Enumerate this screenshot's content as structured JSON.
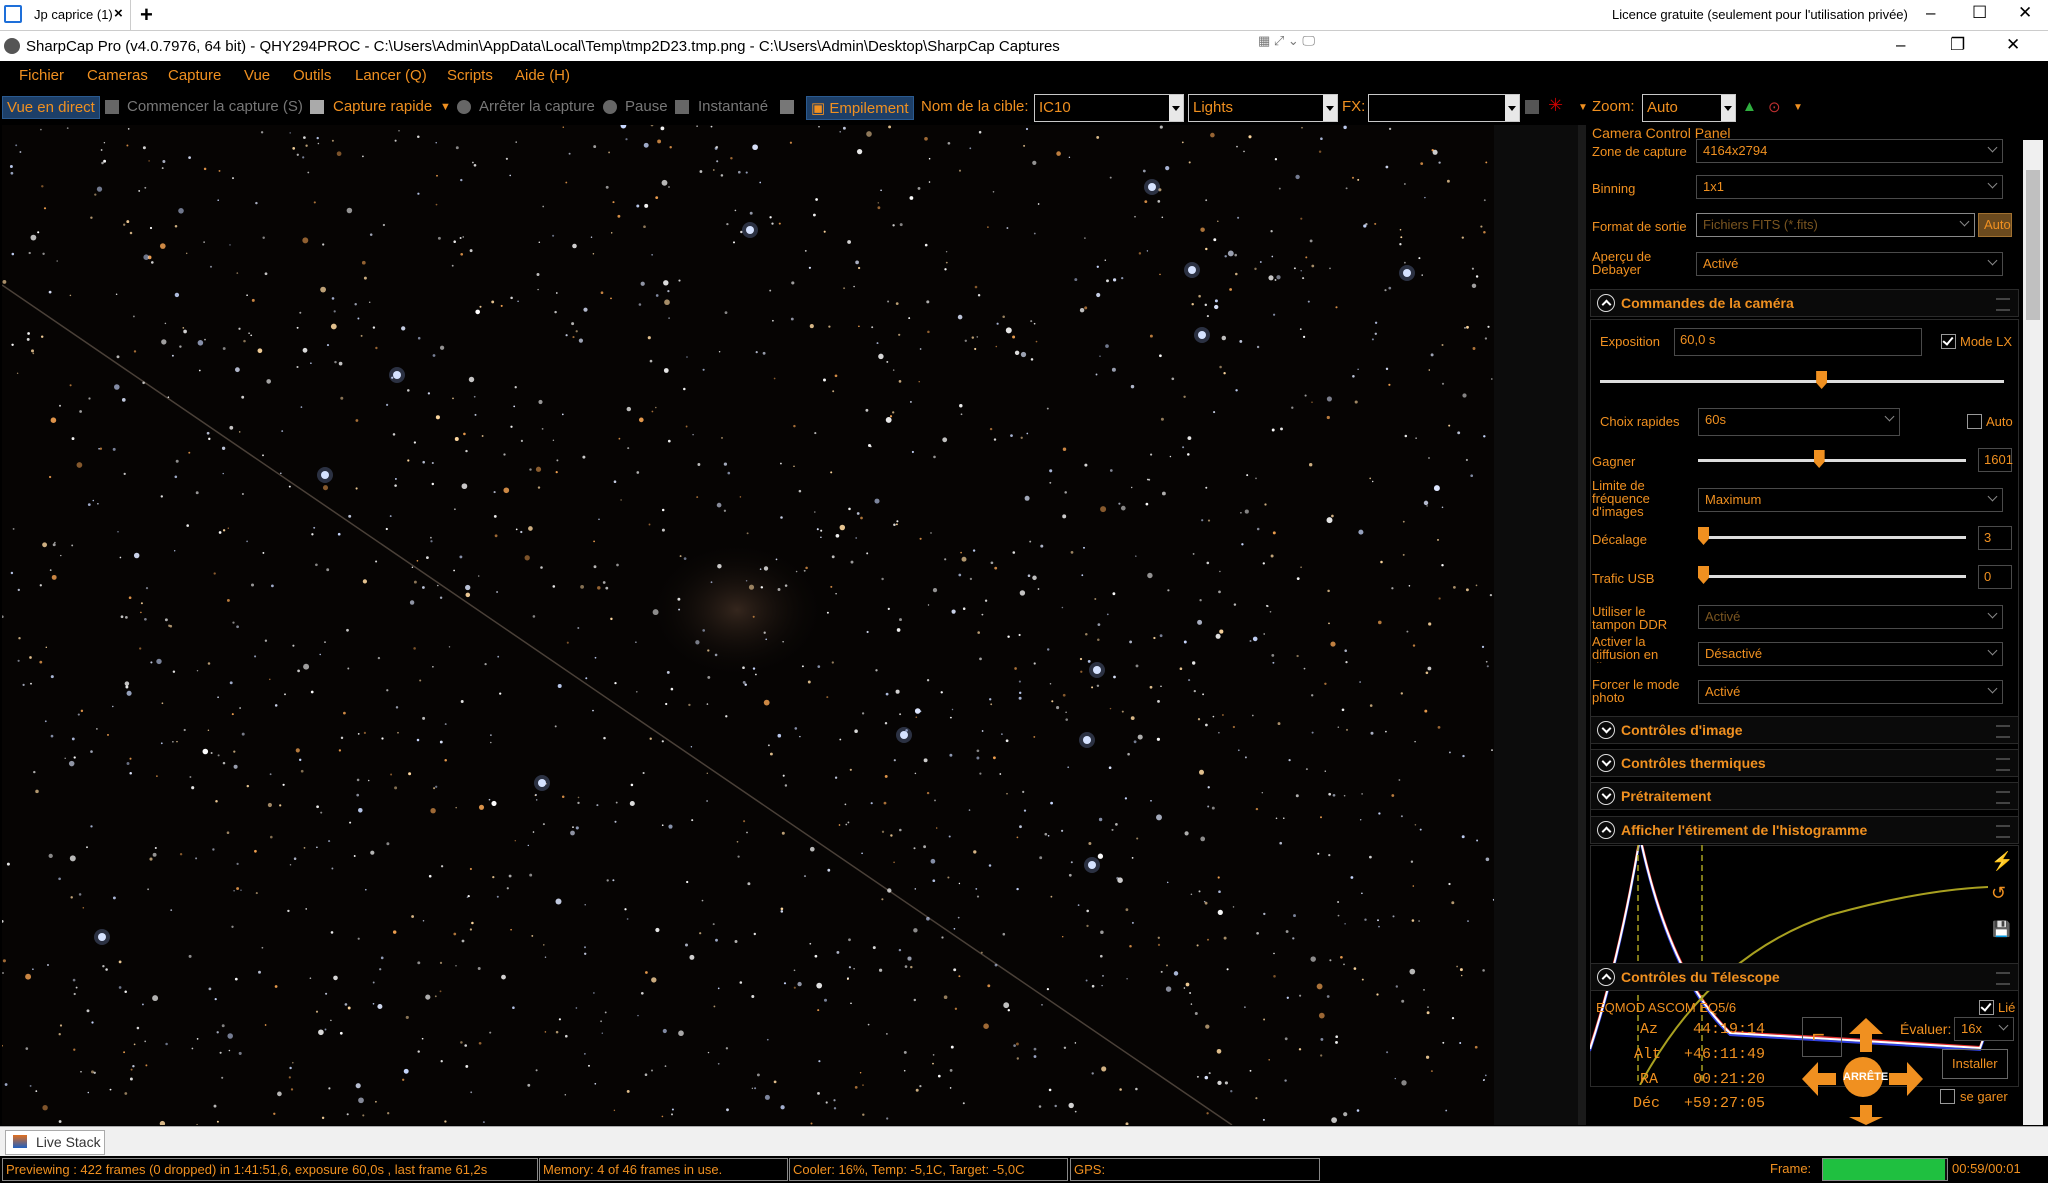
{
  "remote_tab": {
    "label": "Jp caprice (1)",
    "license": "Licence gratuite (seulement pour l'utilisation privée)"
  },
  "window": {
    "title": "SharpCap Pro (v4.0.7976, 64 bit) - QHY294PROC - C:\\Users\\Admin\\AppData\\Local\\Temp\\tmp2D23.tmp.png - C:\\Users\\Admin\\Desktop\\SharpCap Captures"
  },
  "menu": [
    "Fichier",
    "Cameras",
    "Capture",
    "Vue",
    "Outils",
    "Lancer (Q)",
    "Scripts",
    "Aide (H)"
  ],
  "toolbar": {
    "live_view": "Vue en direct",
    "start_capture": "Commencer la capture (S)",
    "quick_capture": "Capture rapide",
    "stop_capture": "Arrêter la capture",
    "pause": "Pause",
    "snapshot": "Instantané",
    "stacking": "Empilement",
    "target_label": "Nom de la cible:",
    "target_value": "IC10",
    "frame_type": "Lights",
    "fx_label": "FX:",
    "fx_value": "",
    "zoom_label": "Zoom:",
    "zoom_value": "Auto"
  },
  "panel": {
    "header": "Camera Control Panel",
    "capture_area_label": "Zone de capture",
    "capture_area_value": "4164x2794",
    "binning_label": "Binning",
    "binning_value": "1x1",
    "output_format_label": "Format de sortie",
    "output_format_value": "Fichiers FITS (*.fits)",
    "auto_button": "Auto",
    "debayer_label": "Aperçu de Debayer",
    "debayer_value": "Activé",
    "camera_controls": {
      "title": "Commandes de la caméra",
      "exposure_label": "Exposition",
      "exposure_value": "60,0 s",
      "mode_lx_label": "Mode LX",
      "mode_lx_checked": true,
      "exposure_slider_level": 0.55,
      "quick_choices_label": "Choix rapides",
      "quick_choices_value": "60s",
      "quick_auto_label": "Auto",
      "gain_label": "Gagner",
      "gain_value": "1601",
      "gain_level": 0.45,
      "frame_limit_label": "Limite de fréquence d'images",
      "frame_limit_value": "Maximum",
      "offset_label": "Décalage",
      "offset_value": "3",
      "offset_level": 0.0,
      "usb_label": "Trafic USB",
      "usb_value": "0",
      "usb_level": 0.0,
      "ddr_label": "Utiliser le tampon DDR",
      "ddr_value": "Activé",
      "broadcast_label": "Activer la diffusion en direct",
      "broadcast_value": "Désactivé",
      "photo_mode_label": "Forcer le mode photo",
      "photo_mode_value": "Activé"
    },
    "image_controls_title": "Contrôles d'image",
    "thermal_controls_title": "Contrôles thermiques",
    "preprocessing_title": "Prétraitement",
    "histogram_title": "Afficher l'étirement de l'histogramme",
    "telescope": {
      "title": "Contrôles du Télescope",
      "mount": "EQMOD ASCOM EQ5/6",
      "linked_label": "Lié",
      "linked_checked": true,
      "az_label": "Az",
      "az_value": "44:19:14",
      "alt_label": "Alt",
      "alt_value": "+46:11:49",
      "ra_label": "RA",
      "ra_value": "00:21:20",
      "dec_label": "Déc",
      "dec_value": "+59:27:05",
      "rate_label": "Évaluer:",
      "rate_value": "16x",
      "stop_label": "ARRÊTE",
      "install_button": "Installer",
      "park_label": "se garer"
    }
  },
  "livestack": {
    "label": "Live Stack"
  },
  "status": {
    "preview": "Previewing : 422 frames (0 dropped) in 1:41:51,6, exposure 60,0s , last frame 61,2s",
    "memory": "Memory: 4 of 46 frames in use.",
    "cooler": "Cooler: 16%, Temp: -5,1C, Target: -5,0C",
    "gps": "GPS:",
    "frame_label": "Frame:",
    "frame_progress": 0.98,
    "frame_time": "00:59/00:01"
  },
  "colors": {
    "accent": "#f09020",
    "panel_bg": "#000000",
    "active_blue": "#1d3f68",
    "progress_green": "#1fc040"
  },
  "icons": [
    "remote-desktop-icon",
    "app-icon",
    "camera-icon",
    "stop-icon",
    "pause-icon",
    "snapshot-icon",
    "stack-icon",
    "crosshair-icon",
    "histogram-icon",
    "arrow-up-icon",
    "arrow-down-icon",
    "arrow-left-icon",
    "arrow-right-icon"
  ]
}
